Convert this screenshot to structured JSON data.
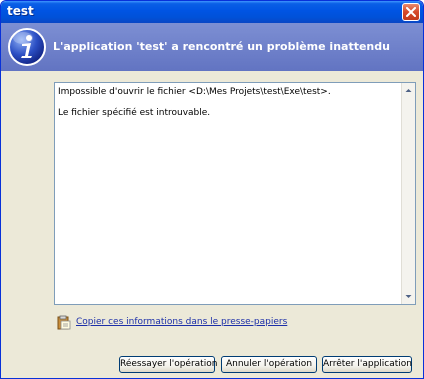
{
  "window": {
    "title": "test",
    "close_icon": "close-icon"
  },
  "header": {
    "icon": "info-icon",
    "message": "L'application 'test' a rencontré un problème inattendu"
  },
  "details": {
    "lines": [
      "Impossible d'ouvrir le fichier <D:\\Mes Projets\\test\\Exe\\test>.",
      "Le fichier spécifié est introuvable."
    ]
  },
  "copy_link": {
    "label": "Copier ces informations dans le presse-papiers",
    "icon": "clipboard-icon"
  },
  "buttons": {
    "retry": "Réessayer l'opération",
    "cancel": "Annuler l'opération",
    "stop": "Arrêter l'application"
  },
  "colors": {
    "titlebar": "#0054e3",
    "header": "#6b7fc9",
    "link": "#1c2fa8",
    "close": "#d5492a"
  }
}
